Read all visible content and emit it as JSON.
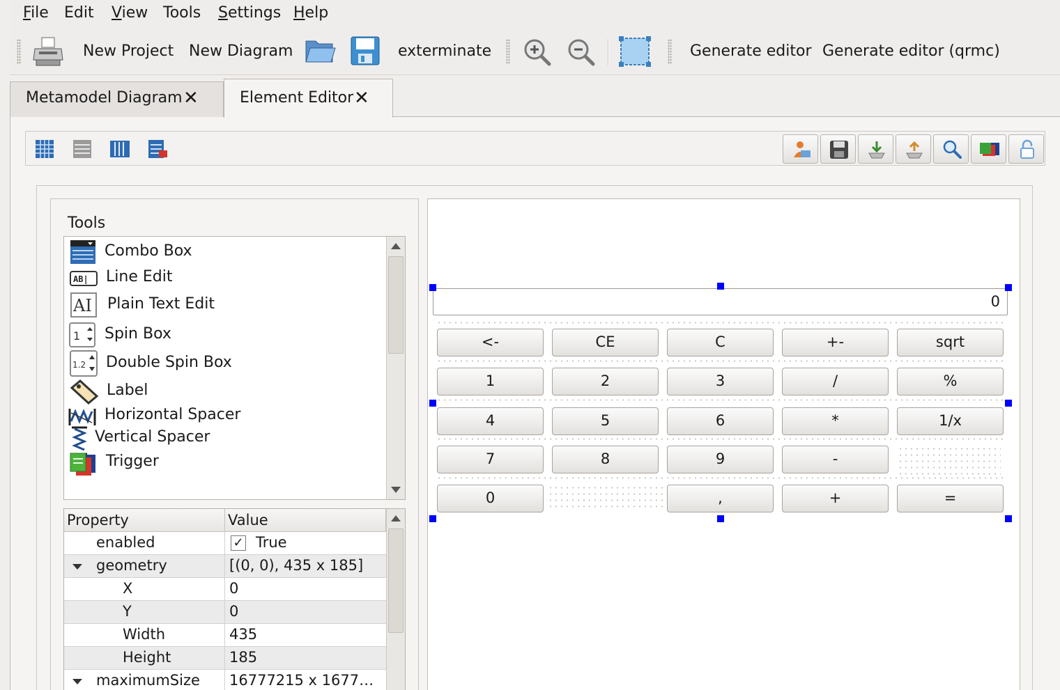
{
  "menu": [
    {
      "label": "File",
      "mnemonic": "F",
      "rest": "ile"
    },
    {
      "label": "Edit",
      "mnemonic": "",
      "rest": "Edit"
    },
    {
      "label": "View",
      "mnemonic": "V",
      "rest": "iew"
    },
    {
      "label": "Tools",
      "mnemonic": "",
      "rest": "Tools"
    },
    {
      "label": "Settings",
      "mnemonic": "S",
      "rest": "ettings"
    },
    {
      "label": "Help",
      "mnemonic": "H",
      "rest": "elp"
    }
  ],
  "toolbar": {
    "new_project": "New Project",
    "new_diagram": "New Diagram",
    "exterminate": "exterminate",
    "generate_editor": "Generate editor",
    "generate_editor_qrmc": "Generate editor (qrmc)"
  },
  "tabs": [
    {
      "label": "Metamodel Diagram",
      "close": "✕"
    },
    {
      "label": "Element Editor",
      "close": "✕"
    }
  ],
  "tools": {
    "title": "Tools",
    "items": [
      "Combo Box",
      "Line Edit",
      "Plain Text Edit",
      "Spin Box",
      "Double Spin Box",
      "Label",
      "Horizontal Spacer",
      "Vertical Spacer",
      "Trigger"
    ]
  },
  "properties": {
    "headers": [
      "Property",
      "Value"
    ],
    "rows": [
      {
        "name": "enabled",
        "value": "True",
        "check": "✓"
      },
      {
        "name": "geometry",
        "value": "[(0, 0), 435 x 185]"
      },
      {
        "name": "X",
        "value": "0"
      },
      {
        "name": "Y",
        "value": "0"
      },
      {
        "name": "Width",
        "value": "435"
      },
      {
        "name": "Height",
        "value": "185"
      },
      {
        "name": "maximumSize",
        "value": "16777215 x 1677…"
      }
    ]
  },
  "calculator": {
    "display": "0",
    "buttons": [
      "<-",
      "CE",
      "C",
      "+-",
      "sqrt",
      "1",
      "2",
      "3",
      "/",
      "%",
      "4",
      "5",
      "6",
      "*",
      "1/x",
      "7",
      "8",
      "9",
      "-",
      "0",
      ",",
      "+",
      "="
    ]
  },
  "icons": {
    "print": "printer-icon",
    "open": "folder-open-icon",
    "save": "save-icon",
    "zoom_in": "zoom-in-icon",
    "zoom_out": "zoom-out-icon",
    "fit": "fit-to-view-icon"
  }
}
